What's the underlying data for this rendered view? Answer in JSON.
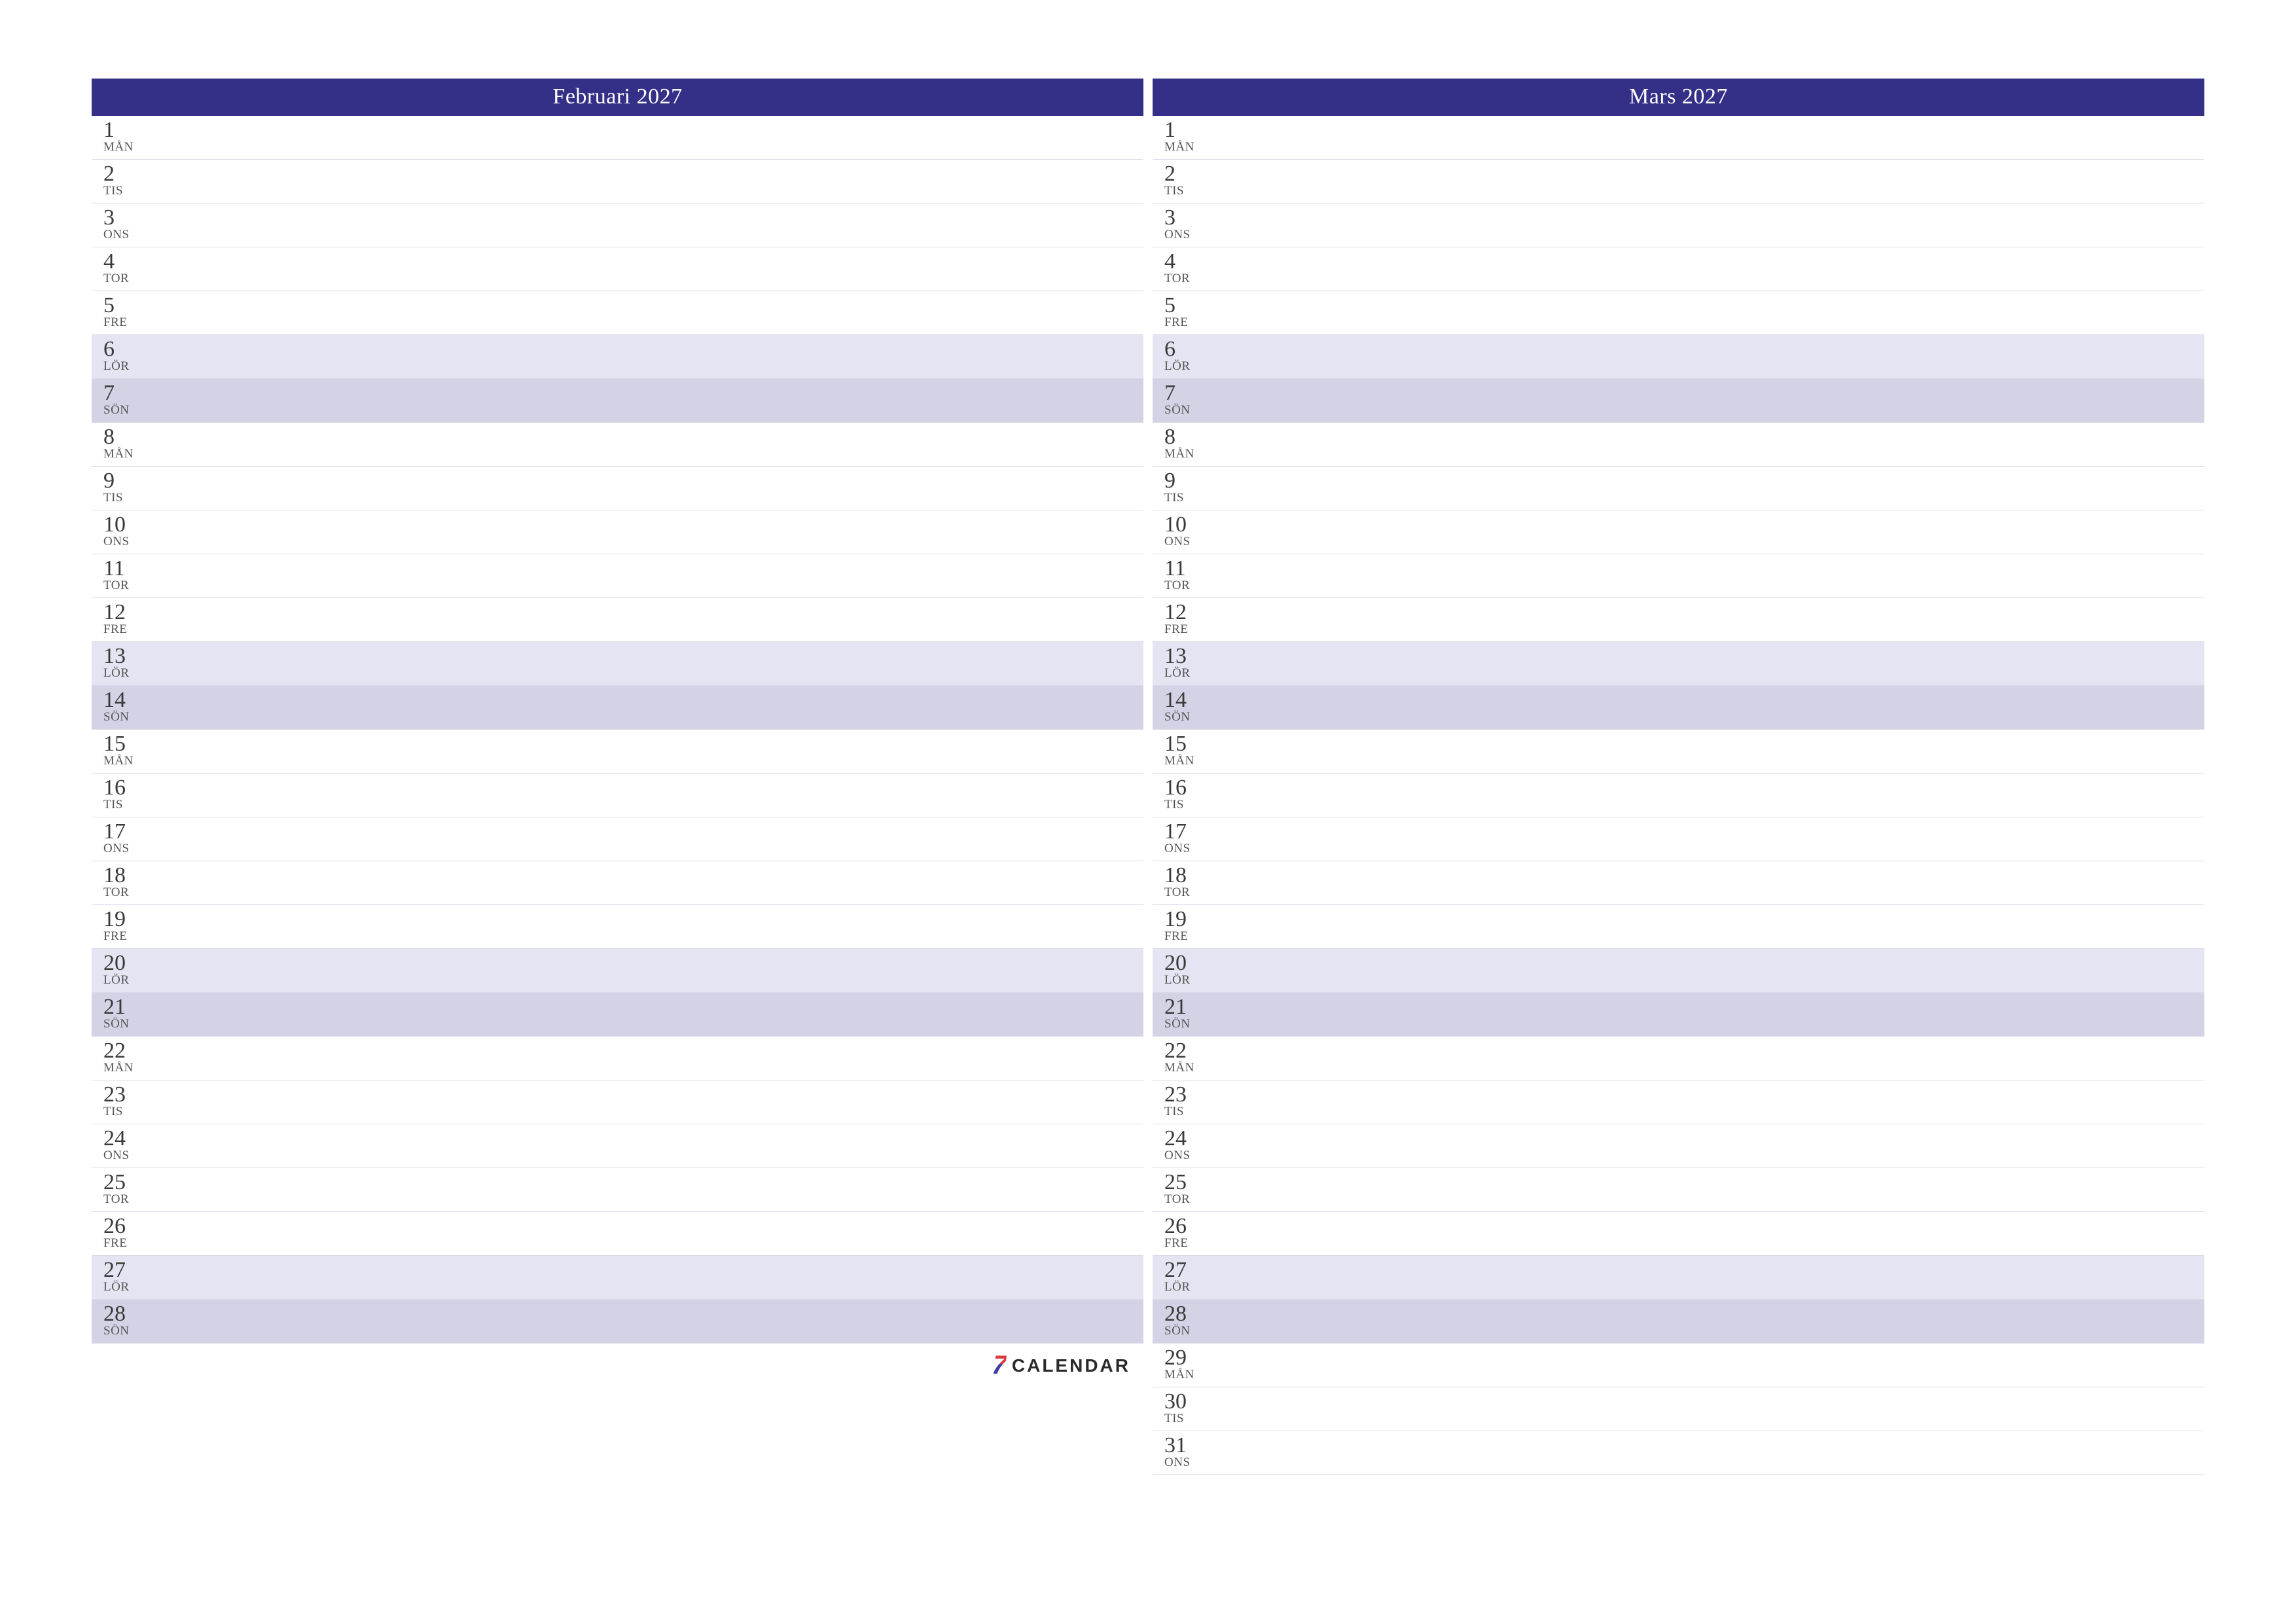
{
  "brand": {
    "mark": "7",
    "word": "CALENDAR"
  },
  "weekdays": [
    "MÅN",
    "TIS",
    "ONS",
    "TOR",
    "FRE",
    "LÖR",
    "SÖN"
  ],
  "months": [
    {
      "title": "Februari 2027",
      "startWeekday": 0,
      "numDays": 28,
      "showLogoAfter": true
    },
    {
      "title": "Mars 2027",
      "startWeekday": 0,
      "numDays": 31,
      "showLogoAfter": false
    }
  ]
}
